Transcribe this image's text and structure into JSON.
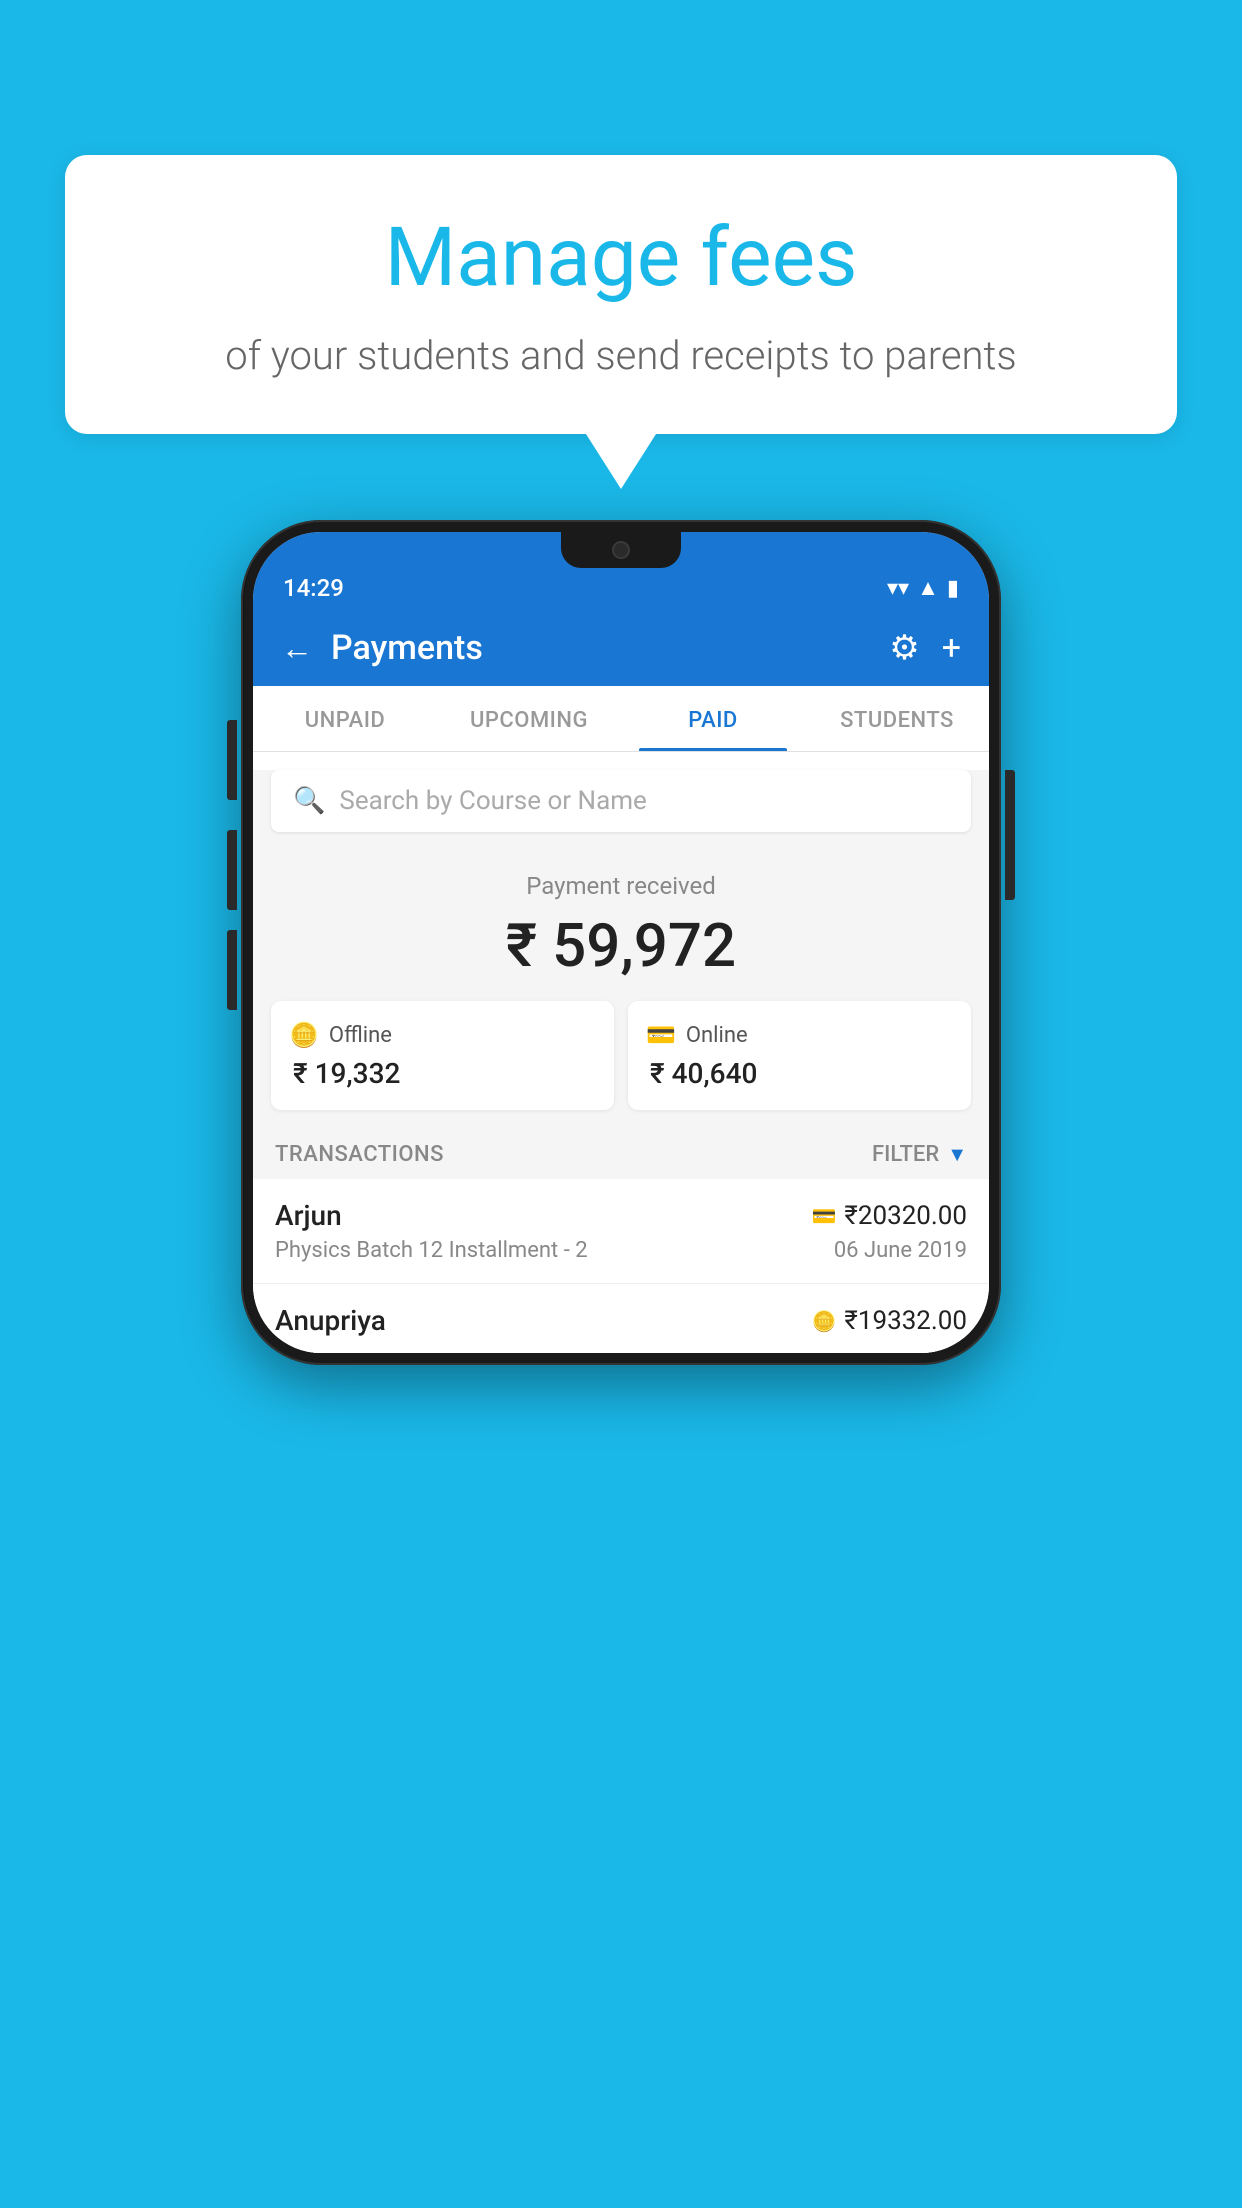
{
  "background_color": "#1ab8e8",
  "speech_bubble": {
    "title": "Manage fees",
    "subtitle": "of your students and send receipts to parents"
  },
  "status_bar": {
    "time": "14:29",
    "wifi": "▼",
    "signal": "▲",
    "battery": "▮"
  },
  "app_bar": {
    "title": "Payments",
    "back_label": "←",
    "gear_label": "⚙",
    "plus_label": "+"
  },
  "tabs": [
    {
      "id": "unpaid",
      "label": "UNPAID",
      "active": false
    },
    {
      "id": "upcoming",
      "label": "UPCOMING",
      "active": false
    },
    {
      "id": "paid",
      "label": "PAID",
      "active": true
    },
    {
      "id": "students",
      "label": "STUDENTS",
      "active": false
    }
  ],
  "search": {
    "placeholder": "Search by Course or Name"
  },
  "payment_summary": {
    "label": "Payment received",
    "amount": "₹ 59,972",
    "offline_label": "Offline",
    "offline_amount": "₹ 19,332",
    "online_label": "Online",
    "online_amount": "₹ 40,640"
  },
  "transactions_section": {
    "label": "TRANSACTIONS",
    "filter_label": "FILTER"
  },
  "transactions": [
    {
      "name": "Arjun",
      "amount": "₹20320.00",
      "course": "Physics Batch 12 Installment - 2",
      "date": "06 June 2019",
      "payment_type": "card"
    },
    {
      "name": "Anupriya",
      "amount": "₹19332.00",
      "course": "",
      "date": "",
      "payment_type": "cash"
    }
  ]
}
